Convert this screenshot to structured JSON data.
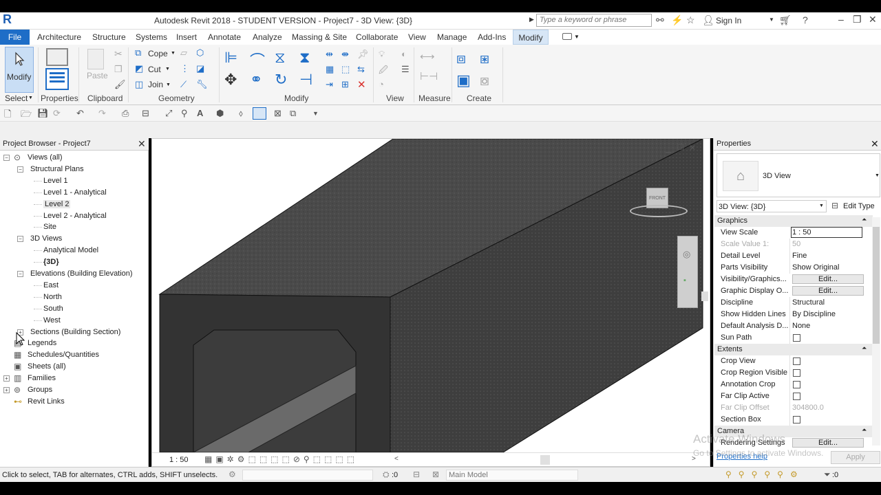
{
  "app": {
    "logo": "R",
    "title": "Autodesk Revit 2018 - STUDENT VERSION -    Project7 - 3D View: {3D}",
    "search_placeholder": "Type a keyword or phrase",
    "sign_in": "Sign In"
  },
  "tabs": [
    "File",
    "Architecture",
    "Structure",
    "Systems",
    "Insert",
    "Annotate",
    "Analyze",
    "Massing & Site",
    "Collaborate",
    "View",
    "Manage",
    "Add-Ins",
    "Modify"
  ],
  "ribbon": {
    "modify_label": "Modify",
    "select_label": "Select",
    "properties_label": "Properties",
    "paste_label": "Paste",
    "cope_label": "Cope",
    "cut_label": "Cut",
    "join_label": "Join",
    "groups": [
      "Clipboard",
      "Geometry",
      "Modify",
      "View",
      "Measure",
      "Create"
    ]
  },
  "project_browser": {
    "title": "Project Browser - Project7",
    "items": [
      {
        "label": "Views (all)",
        "level": 0,
        "toggle": "−"
      },
      {
        "label": "Structural Plans",
        "level": 1,
        "toggle": "−"
      },
      {
        "label": "Level 1",
        "level": 2
      },
      {
        "label": "Level 1 - Analytical",
        "level": 2
      },
      {
        "label": "Level 2",
        "level": 2
      },
      {
        "label": "Level 2 - Analytical",
        "level": 2
      },
      {
        "label": "Site",
        "level": 2
      },
      {
        "label": "3D Views",
        "level": 1,
        "toggle": "−"
      },
      {
        "label": "Analytical Model",
        "level": 2
      },
      {
        "label": "{3D}",
        "level": 2
      },
      {
        "label": "Elevations (Building Elevation)",
        "level": 1,
        "toggle": "−"
      },
      {
        "label": "East",
        "level": 2
      },
      {
        "label": "North",
        "level": 2
      },
      {
        "label": "South",
        "level": 2
      },
      {
        "label": "West",
        "level": 2
      },
      {
        "label": "Sections (Building Section)",
        "level": 1,
        "toggle": "+"
      },
      {
        "label": "Legends",
        "level": 0
      },
      {
        "label": "Schedules/Quantities",
        "level": 0
      },
      {
        "label": "Sheets (all)",
        "level": 0
      },
      {
        "label": "Families",
        "level": 0,
        "toggle": "+"
      },
      {
        "label": "Groups",
        "level": 0,
        "toggle": "+"
      },
      {
        "label": "Revit Links",
        "level": 0
      }
    ]
  },
  "view": {
    "scale": "1 : 50",
    "viewcube_face": "FRONT"
  },
  "properties": {
    "title": "Properties",
    "type_name": "3D View",
    "selector": "3D View: {3D}",
    "edit_type": "Edit Type",
    "sections": {
      "graphics": "Graphics",
      "extents": "Extents",
      "camera": "Camera"
    },
    "rows": {
      "view_scale": {
        "label": "View Scale",
        "value": "1 : 50"
      },
      "scale_value": {
        "label": "Scale Value    1:",
        "value": "50"
      },
      "detail_level": {
        "label": "Detail Level",
        "value": "Fine"
      },
      "parts_visibility": {
        "label": "Parts Visibility",
        "value": "Show Original"
      },
      "vis_graphics": {
        "label": "Visibility/Graphics...",
        "value": "Edit..."
      },
      "graphic_display": {
        "label": "Graphic Display O...",
        "value": "Edit..."
      },
      "discipline": {
        "label": "Discipline",
        "value": "Structural"
      },
      "hidden_lines": {
        "label": "Show Hidden Lines",
        "value": "By Discipline"
      },
      "analysis_display": {
        "label": "Default Analysis D...",
        "value": "None"
      },
      "sun_path": {
        "label": "Sun Path"
      },
      "crop_view": {
        "label": "Crop View"
      },
      "crop_region": {
        "label": "Crop Region Visible"
      },
      "annotation_crop": {
        "label": "Annotation Crop"
      },
      "far_clip_active": {
        "label": "Far Clip Active"
      },
      "far_clip_offset": {
        "label": "Far Clip Offset",
        "value": "304800.0"
      },
      "section_box": {
        "label": "Section Box"
      },
      "rendering": {
        "label": "Rendering Settings",
        "value": "Edit..."
      }
    },
    "help": "Properties help",
    "apply": "Apply",
    "watermark": "Activate Windows",
    "watermark_sub": "Go to Settings to activate Windows."
  },
  "status": {
    "text": "Click to select, TAB for alternates, CTRL adds, SHIFT unselects.",
    "count": ":0",
    "model": "Main Model",
    "filter_count": ":0"
  }
}
